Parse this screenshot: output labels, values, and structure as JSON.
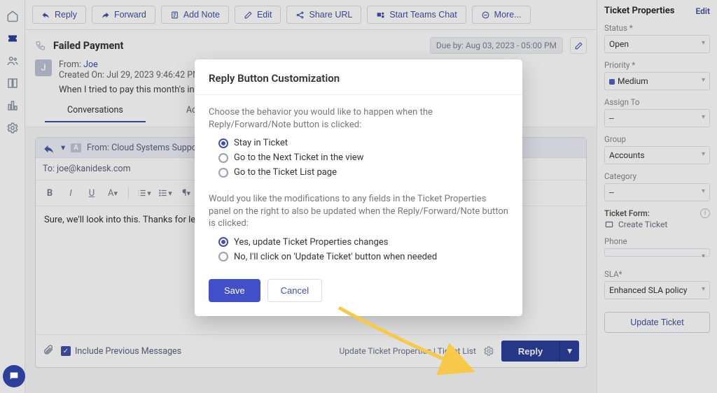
{
  "toolbar": {
    "reply": "Reply",
    "forward": "Forward",
    "addnote": "Add Note",
    "edit": "Edit",
    "shareurl": "Share URL",
    "teams": "Start Teams Chat",
    "more": "More..."
  },
  "ticket": {
    "subject": "Failed Payment",
    "due_label": "Due by: Aug 03, 2023 - 05:00 PM",
    "avatar_initial": "J",
    "from_label": "From: ",
    "from_name": "Joe",
    "created": "Created On: Jul 29, 2023 9:46:42 PM via Phone or Other",
    "description": "When I tried to pay this month's invoice, I kept getting a payment fi"
  },
  "tabs": {
    "conversations": "Conversations",
    "activities": "Activities"
  },
  "composer": {
    "from_label": "From: ",
    "from_value": "Cloud Systems Support <support@cloudsystems.",
    "to_label": "To: ",
    "to_value": "joe@kanidesk.com",
    "body": "Sure, we'll look into this. Thanks for letting us know about this.",
    "include_prev": "Include Previous Messages",
    "foot_links": "Update Ticket Properties | Ticket List",
    "reply_btn": "Reply"
  },
  "rightpanel": {
    "title": "Ticket Properties",
    "edit": "Edit",
    "status_label": "Status *",
    "status_value": "Open",
    "priority_label": "Priority *",
    "priority_value": "Medium",
    "assignto_label": "Assign To",
    "assignto_value": "--",
    "group_label": "Group",
    "group_value": "Accounts",
    "category_label": "Category",
    "category_value": "--",
    "ticketform_label": "Ticket Form:",
    "ticketform_value": "Create Ticket",
    "phone_label": "Phone",
    "phone_value": "",
    "sla_label": "SLA*",
    "sla_value": "Enhanced SLA policy",
    "update": "Update Ticket"
  },
  "modal": {
    "title": "Reply Button Customization",
    "q1": "Choose the behavior you would like to happen when the Reply/Forward/Note button is clicked:",
    "opt1a": "Stay in Ticket",
    "opt1b": "Go to the Next Ticket in the view",
    "opt1c": "Go to the Ticket List page",
    "q2": "Would you like the modifications to any fields in the Ticket Properties panel on the right to also be updated when the Reply/Forward/Note button is clicked:",
    "opt2a": "Yes, update Ticket Properties changes",
    "opt2b": "No, I'll click on 'Update Ticket' button when needed",
    "save": "Save",
    "cancel": "Cancel"
  }
}
